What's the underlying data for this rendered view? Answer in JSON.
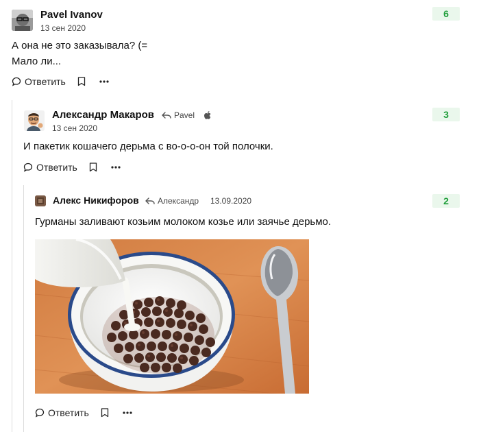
{
  "comments": [
    {
      "author": "Pavel Ivanov",
      "date": "13 сен 2020",
      "score": "6",
      "lines": [
        "А она не это заказывала? (=",
        "Мало ли..."
      ],
      "reply_label": "Ответить"
    },
    {
      "author": "Александр Макаров",
      "reply_to": "Pavel",
      "date": "13 сен 2020",
      "score": "3",
      "lines": [
        "И пакетик кошачего дерьма с во-о-о-он той полочки."
      ],
      "reply_label": "Ответить"
    },
    {
      "author": "Алекс Никифоров",
      "reply_to": "Александр",
      "date": "13.09.2020",
      "score": "2",
      "lines": [
        "Гурманы заливают козьим молоком козье или заячье дерьмо."
      ],
      "reply_label": "Ответить"
    }
  ],
  "icons": {
    "reply": "speech-bubble-icon",
    "bookmark": "bookmark-icon",
    "more": "more-dots-icon",
    "reply_arrow": "reply-arrow-icon",
    "apple": "apple-icon"
  },
  "colors": {
    "score_bg": "#eaf7ec",
    "score_text": "#1f9e3a",
    "thread_line": "#dcdcdc"
  }
}
